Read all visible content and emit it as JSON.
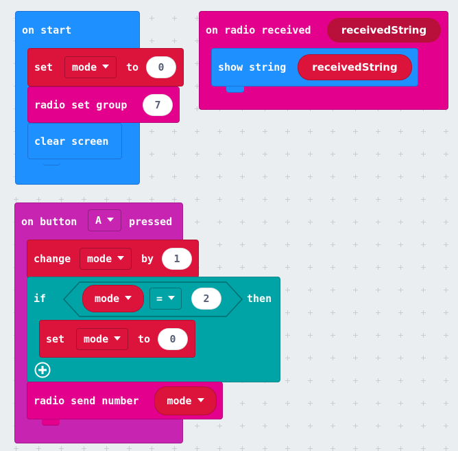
{
  "colors": {
    "workspace": "#ebeef0",
    "basic": "#1e90ff",
    "variables": "#dc143c",
    "radio": "#e3008c",
    "input": "#c724b1",
    "logic": "#00a4a6",
    "reporter_dark": "#b8103a"
  },
  "on_start": {
    "label": "on start",
    "set_block": {
      "set": "set",
      "variable": "mode",
      "to": "to",
      "value": "0"
    },
    "radio_group": {
      "label": "radio set group",
      "value": "7"
    },
    "clear_screen": {
      "label": "clear screen"
    }
  },
  "on_radio": {
    "label": "on radio received",
    "param": "receivedString",
    "show_string": {
      "label": "show string",
      "value": "receivedString"
    }
  },
  "on_button": {
    "label_on": "on button",
    "button": "A",
    "label_pressed": "pressed",
    "change_block": {
      "change": "change",
      "variable": "mode",
      "by": "by",
      "value": "1"
    },
    "if_block": {
      "if": "if",
      "left": "mode",
      "operator": "=",
      "right": "2",
      "then": "then",
      "inner_set": {
        "set": "set",
        "variable": "mode",
        "to": "to",
        "value": "0"
      },
      "add_icon": "plus-circle-icon"
    },
    "send_block": {
      "label": "radio send number",
      "value": "mode"
    }
  }
}
